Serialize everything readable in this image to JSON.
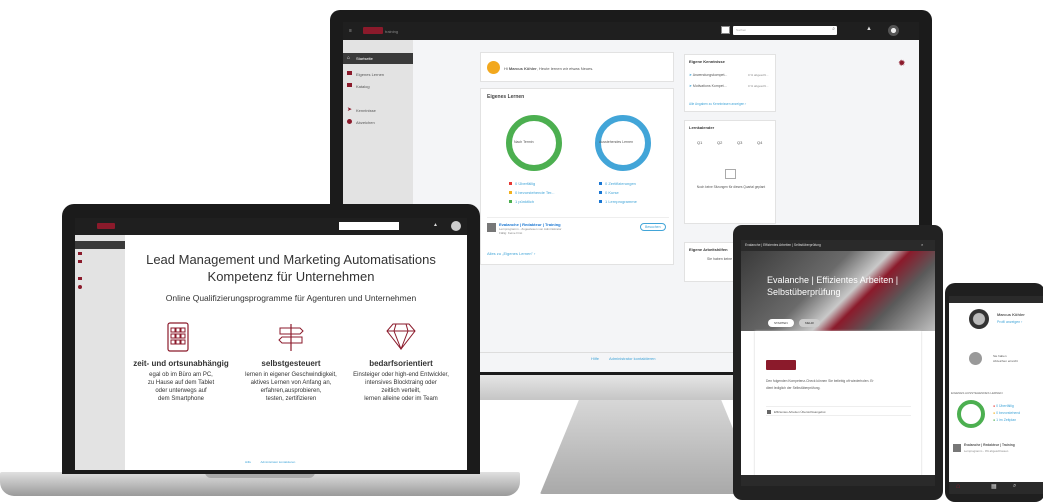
{
  "monitor": {
    "search_placeholder": "Suchen",
    "brand_suffix": "training",
    "nav": [
      {
        "label": "Startseite",
        "active": true
      },
      {
        "label": "Eigenes Lernen"
      },
      {
        "label": "Katalog"
      },
      {
        "label": "Kenntnisse"
      },
      {
        "label": "Abzeichen"
      }
    ],
    "welcome": {
      "prefix": "Hi ",
      "name": "Marcus Köhler",
      "suffix": ", Heute lernen wir etwas Neues."
    },
    "eigenes_lernen": {
      "title": "Eigenes Lernen",
      "ring1_label": "Nach Termin",
      "ring2_label": "Ausstehendes Lernen",
      "legend_left": [
        {
          "text": "0 Überfällig",
          "color": "#e53935"
        },
        {
          "text": "0 bevorstehende Ter...",
          "color": "#f2b01e"
        },
        {
          "text": "1 pünktlich",
          "color": "#4caf50"
        }
      ],
      "legend_right": [
        {
          "text": "0 Zertifizierungen",
          "color": "#1976d2"
        },
        {
          "text": "0 Kurse",
          "color": "#1976d2"
        },
        {
          "text": "1 Lernprogramme",
          "color": "#1976d2"
        }
      ],
      "item_title": "Evalanche | Redakteur | Training",
      "item_sub1": "Lernprogramm - Zugewiesen von Administrator",
      "item_sub2": "Fällig: Keine Frist",
      "item_button": "Besuchen",
      "link": "Alles zu „Eigenes Lernen\" ›"
    },
    "kenntnisse": {
      "title": "Eigene Kenntnisse",
      "rows": [
        {
          "name": "Anwendungskompet...",
          "value": "0 % abgeschl..."
        },
        {
          "name": "Motivations Kompet...",
          "value": "0 % abgeschl..."
        }
      ],
      "link": "Alle Angaben zu Kenntnissen anzeigen ›"
    },
    "lernkalender": {
      "title": "Lernkalender",
      "quarters": [
        "Q1",
        "Q2",
        "Q3",
        "Q4"
      ],
      "empty": "Noch keine Sitzungen für dieses Quartal geplant"
    },
    "arbeitshilfen": {
      "title": "Eigene Arbeitshilfen",
      "text": "Sie haben keine"
    },
    "footer": {
      "help": "Hilfe",
      "admin": "Administrator kontaktieren"
    }
  },
  "laptop": {
    "headline1": "Lead Management und Marketing Automatisations",
    "headline2": "Kompetenz für Unternehmen",
    "subline": "Online Qualifizierungsprogramme für Agenturen und Unternehmen",
    "features": [
      {
        "title": "zeit- und ortsunabhängig",
        "lines": [
          "egal ob im Büro am PC,",
          "zu Hause auf dem Tablet",
          "oder unterwegs auf",
          "dem Smartphone"
        ]
      },
      {
        "title": "selbstgesteuert",
        "lines": [
          "lernen in eigener Geschwindigkeit,",
          "aktives Lernen von Anfang an,",
          "erfahren,ausprobieren,",
          "testen, zertifizieren"
        ]
      },
      {
        "title": "bedarfsorientiert",
        "lines": [
          "Einsteiger oder high-end Entwickler,",
          "intensives Blocktraing oder",
          "zeitlich verteilt,",
          "lernen alleine oder im Team"
        ]
      }
    ],
    "footer": {
      "help": "Hilfe",
      "admin": "Administrator kontaktieren"
    }
  },
  "tablet": {
    "topbar_title": "Evalanche | Effizientes Arbeiten | Selbstüberprüfung",
    "hero_title1": "Evalanche | Effizientes Arbeiten |",
    "hero_title2": "Selbstüberprüfung",
    "btn1": "STARTEN",
    "btn2": "MEHR",
    "body1": "Den folgenden Kompetenz-Check können Sie beliebig oft wiederholen. Er",
    "body2": "dient lediglich der Selbstüberprüfung.",
    "row": "Effizientes Arbeiten Übersichtsangebot"
  },
  "phone": {
    "user": "Marcus Köhler",
    "profile_link": "Profil anzeigen ›",
    "badge_text1": "Sie haben",
    "badge_text2": "Abzeichen erreicht",
    "section": "EIGENES AUSSTEHENDES LERNEN",
    "legend": [
      {
        "text": "0 Überfällig",
        "color": "#e53935"
      },
      {
        "text": "0 bevorstehend",
        "color": "#f2b01e"
      },
      {
        "text": "1 im Zeitplan",
        "color": "#4caf50"
      }
    ],
    "item_title": "Evalanche | Redakteur | Training",
    "item_sub": "Lernprogramm - 0% abgeschlossen"
  },
  "colors": {
    "brand": "#8b1a2b",
    "green": "#4caf50",
    "blue": "#42a5d8"
  }
}
